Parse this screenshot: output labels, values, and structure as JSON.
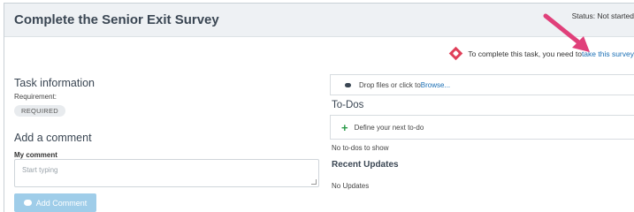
{
  "header": {
    "title": "Complete the Senior Exit Survey",
    "status": "Status: Not started"
  },
  "notice": {
    "text": "To complete this task, you need to ",
    "link": "take this survey"
  },
  "task_info": {
    "heading": "Task information",
    "requirement_label": "Requirement:",
    "requirement_badge": "REQUIRED"
  },
  "comment": {
    "heading": "Add a comment",
    "field_label": "My comment",
    "placeholder": "Start typing",
    "button": "Add Comment"
  },
  "files": {
    "text": "Drop files or click to ",
    "browse": "Browse..."
  },
  "todos": {
    "heading": "To-Dos",
    "define": "Define your next to-do",
    "empty": "No to-dos to show"
  },
  "updates": {
    "heading": "Recent Updates",
    "empty": "No Updates"
  },
  "colors": {
    "accent": "#1a6fb5",
    "arrow": "#e0407a",
    "button": "#9fcde9",
    "plus": "#2c9b4b"
  }
}
